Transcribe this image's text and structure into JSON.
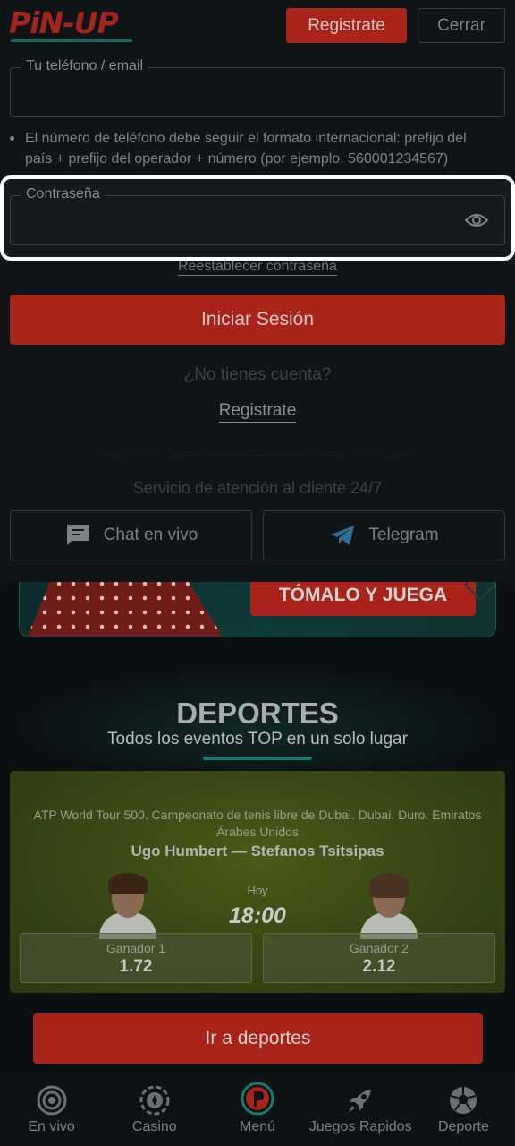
{
  "header": {
    "logo_text": "PiN-UP",
    "register_label": "Registrate",
    "close_label": "Cerrar"
  },
  "login": {
    "phone_label": "Tu teléfono / email",
    "phone_value": "",
    "phone_hint": "El número de teléfono debe seguir el formato internacional: prefijo del país + prefijo del operador + número (por ejemplo, 560001234567)",
    "password_label": "Contraseña",
    "password_value": "",
    "reset_password": "Reestablecer contraseña",
    "login_button": "Iniciar Sesión",
    "no_account": "¿No tienes cuenta?",
    "register_link": "Registrate"
  },
  "support": {
    "title": "Servicio de atención al cliente 24/7",
    "chat_label": "Chat en vivo",
    "telegram_label": "Telegram"
  },
  "promo": {
    "cta_label": "TÓMALO Y JUEGA"
  },
  "sports": {
    "title": "DEPORTES",
    "subtitle": "Todos los eventos TOP en un solo lugar",
    "match": {
      "league": "ATP World Tour 500. Campeonato de tenis libre de Dubai. Dubai. Duro. Emiratos Árabes Unidos",
      "teams": "Ugo Humbert — Stefanos Tsitsipas",
      "day": "Hoy",
      "time": "18:00",
      "odds": [
        {
          "label": "Ganador 1",
          "value": "1.72"
        },
        {
          "label": "Ganador 2",
          "value": "2.12"
        }
      ]
    },
    "cta_label": "Ir a deportes"
  },
  "bottom_nav": {
    "items": [
      {
        "label": "En vivo",
        "icon": "live-icon"
      },
      {
        "label": "Casino",
        "icon": "casino-chip-icon"
      },
      {
        "label": "Menú",
        "icon": "pinup-logo-icon"
      },
      {
        "label": "Juegos Rapidos",
        "icon": "rocket-icon"
      },
      {
        "label": "Deporte",
        "icon": "soccer-ball-icon"
      }
    ]
  },
  "colors": {
    "accent_red": "#a8241a",
    "accent_teal": "#157c6d",
    "background": "#0f1517"
  }
}
